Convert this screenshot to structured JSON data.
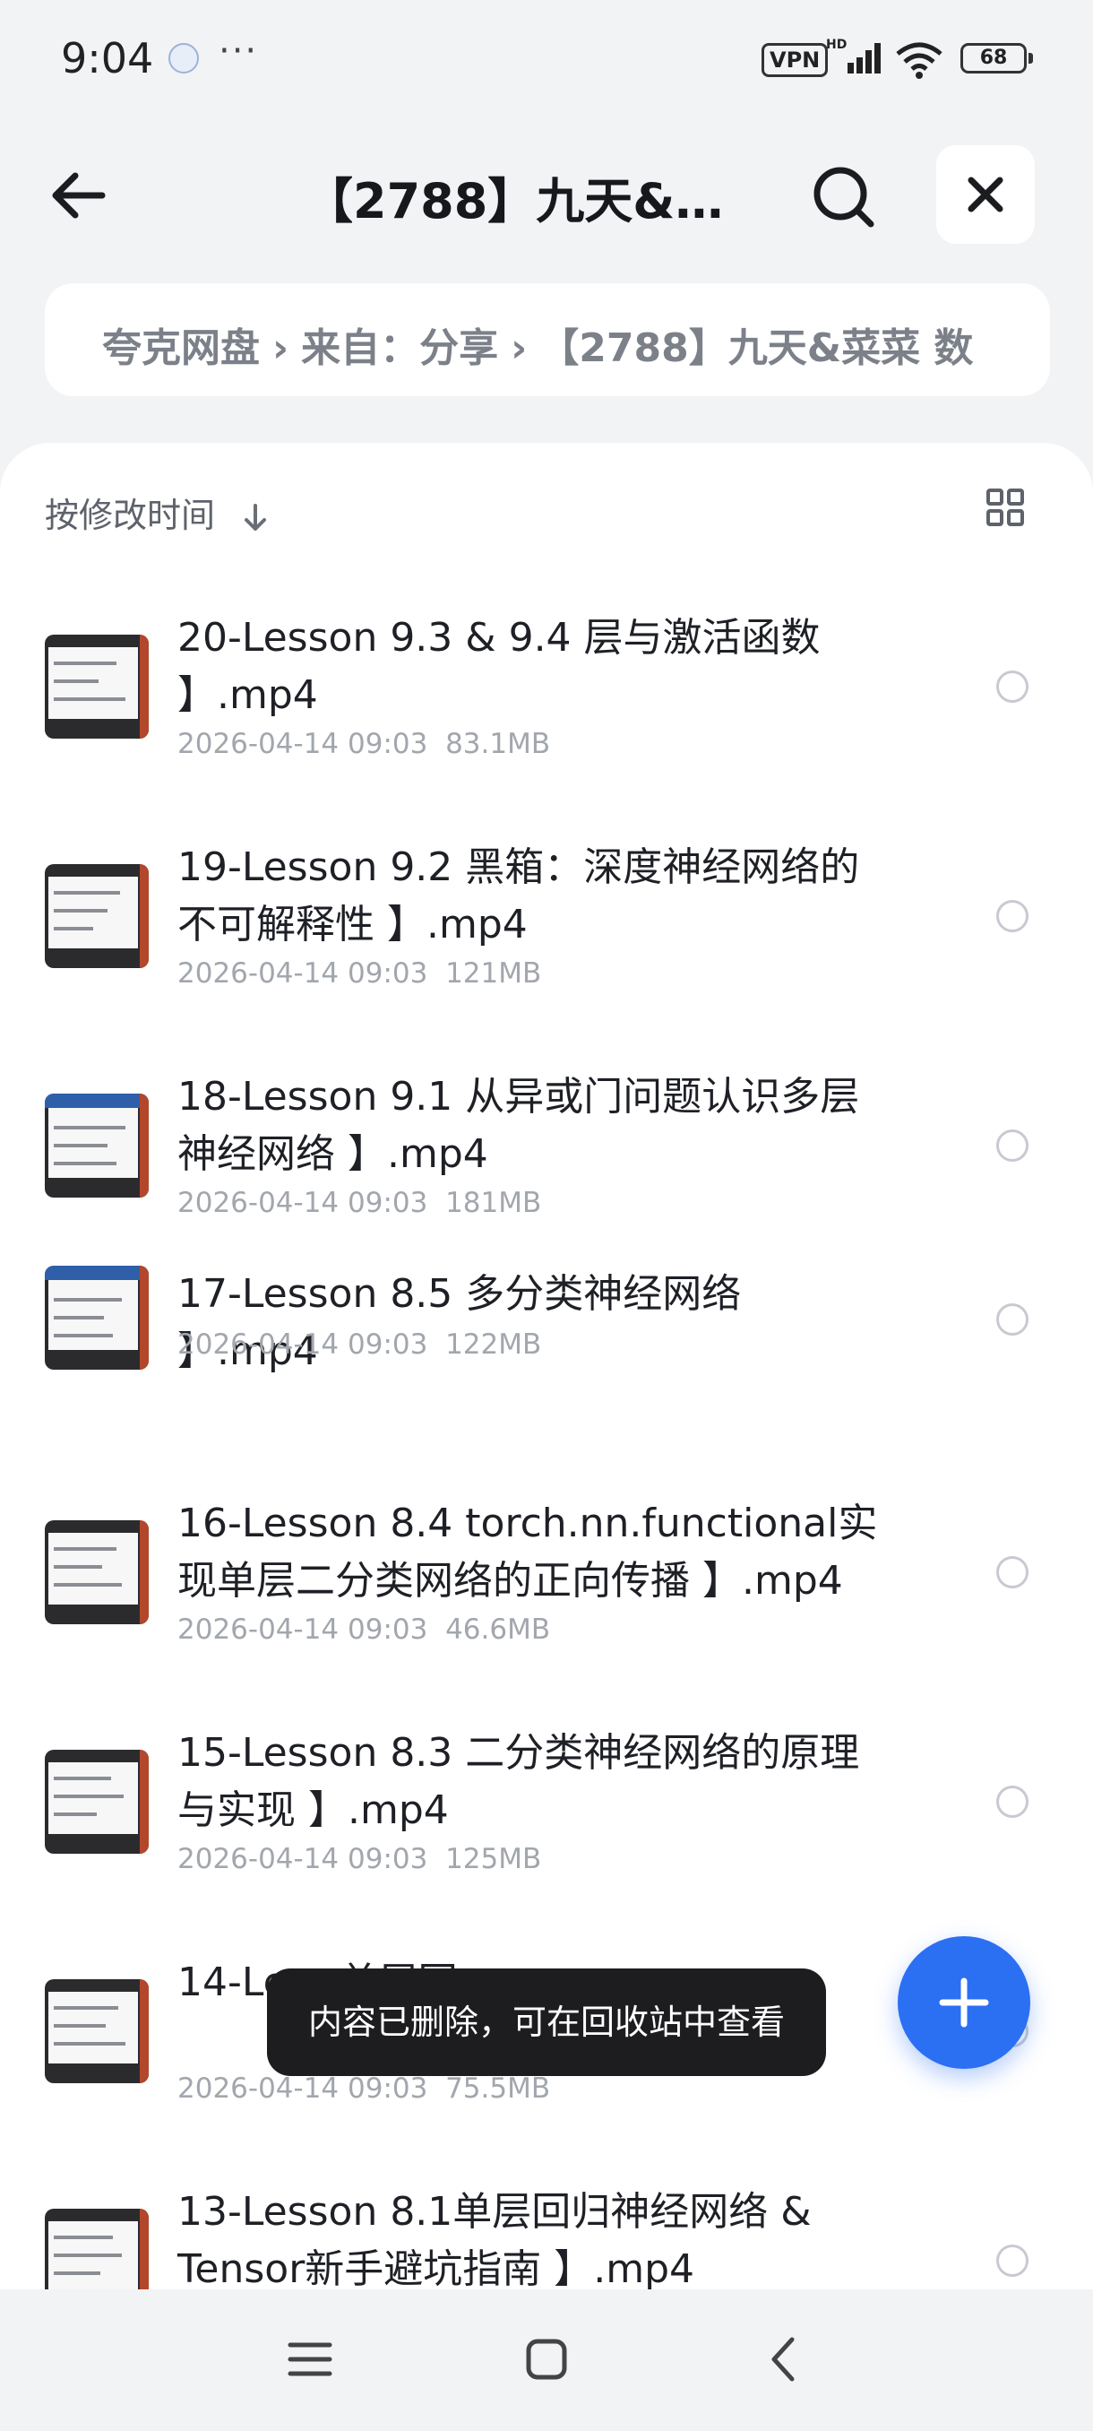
{
  "status_bar": {
    "time": "9:04",
    "more": "···",
    "vpn": "VPN",
    "battery": "68"
  },
  "header": {
    "title": "【2788】九天&菜…"
  },
  "breadcrumb": {
    "items": [
      "夸克网盘",
      "来自：分享",
      "【2788】九天&菜菜 数"
    ],
    "separator": "›"
  },
  "toolbar": {
    "sort_label": "按修改时间"
  },
  "files": [
    {
      "name": "20-Lesson 9.3 & 9.4 层与激活函数 】.mp4",
      "date": "2026-04-14 09:03",
      "size": "83.1MB"
    },
    {
      "name": "19-Lesson 9.2 黑箱：深度神经网络的不可解释性 】.mp4",
      "date": "2026-04-14 09:03",
      "size": "121MB"
    },
    {
      "name": "18-Lesson 9.1 从异或门问题认识多层神经网络 】.mp4",
      "date": "2026-04-14 09:03",
      "size": "181MB"
    },
    {
      "name": "17-Lesson 8.5 多分类神经网络 】.mp4",
      "date": "2026-04-14 09:03",
      "size": "122MB"
    },
    {
      "name": "16-Lesson 8.4 torch.nn.functional实现单层二分类网络的正向传播 】.mp4",
      "date": "2026-04-14 09:03",
      "size": "46.6MB"
    },
    {
      "name": "15-Lesson 8.3 二分类神经网络的原理与实现 】.mp4",
      "date": "2026-04-14 09:03",
      "size": "125MB"
    },
    {
      "name": "14-Le… 单层回…",
      "date": "2026-04-14 09:03",
      "size": "75.5MB"
    },
    {
      "name": "13-Lesson 8.1单层回归神经网络 & Tensor新手避坑指南 】.mp4",
      "date": "",
      "size": ""
    }
  ],
  "toast": {
    "message": "内容已删除，可在回收站中查看"
  },
  "colors": {
    "accent": "#2b6ff3",
    "background": "#f2f3f5",
    "toast_bg": "#1d1d20"
  },
  "icons": [
    "back-arrow-icon",
    "search-icon",
    "close-icon",
    "sort-down-icon",
    "grid-view-icon",
    "plus-icon",
    "menu-icon",
    "home-icon",
    "back-icon"
  ]
}
